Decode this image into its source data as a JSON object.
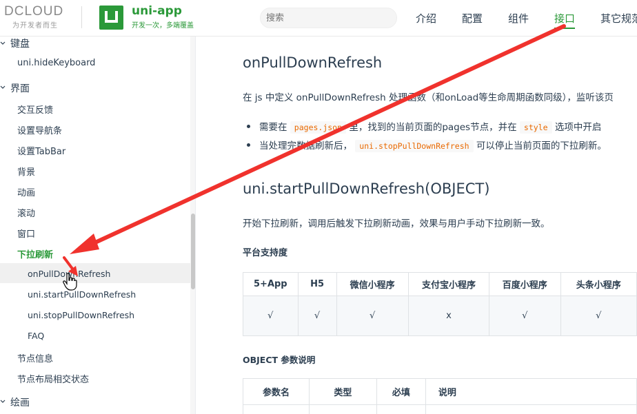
{
  "header": {
    "dcloud_logo": "DCLOUD",
    "dcloud_slogan": "为开发者而生",
    "app_name": "uni-app",
    "app_tagline": "开发一次，多端覆盖",
    "search_placeholder": "搜索",
    "nav": [
      "介绍",
      "配置",
      "组件",
      "接口",
      "其它规范"
    ],
    "active_nav": "接口",
    "accent": "#2b9939"
  },
  "sidebar": {
    "group_keyboard": "键盘",
    "hide_keyboard": "uni.hideKeyboard",
    "group_ui": "界面",
    "items": [
      "交互反馈",
      "设置导航条",
      "设置TabBar",
      "背景",
      "动画",
      "滚动",
      "窗口"
    ],
    "active_item": "下拉刷新",
    "sub_items": [
      "onPullDownRefresh",
      "uni.startPullDownRefresh",
      "uni.stopPullDownRefresh",
      "FAQ"
    ],
    "items_after": [
      "节点信息",
      "节点布局相交状态"
    ],
    "group_draw": "绘画"
  },
  "content": {
    "heading1": "onPullDownRefresh",
    "para1": "在 js 中定义 onPullDownRefresh 处理函数（和onLoad等生命周期函数同级），监听该页",
    "bullet1_pre": "需要在",
    "bullet1_code": "pages.json",
    "bullet1_mid": "里，找到的当前页面的pages节点，并在",
    "bullet1_code2": "style",
    "bullet1_post": "选项中开启",
    "bullet2_pre": "当处理完数据刷新后，",
    "bullet2_code": "uni.stopPullDownRefresh",
    "bullet2_post": "可以停止当前页面的下拉刷新。",
    "heading2": "uni.startPullDownRefresh(OBJECT)",
    "para2": "开始下拉刷新，调用后触发下拉刷新动画，效果与用户手动下拉刷新一致。",
    "platform_title": "平台支持度",
    "platform_headers": [
      "5+App",
      "H5",
      "微信小程序",
      "支付宝小程序",
      "百度小程序",
      "头条小程序"
    ],
    "platform_values": [
      "√",
      "√",
      "√",
      "x",
      "√",
      "√"
    ],
    "object_title": "OBJECT 参数说明",
    "param_headers": [
      "参数名",
      "类型",
      "必填",
      "说明"
    ]
  },
  "annotation_color": "#f0322d"
}
